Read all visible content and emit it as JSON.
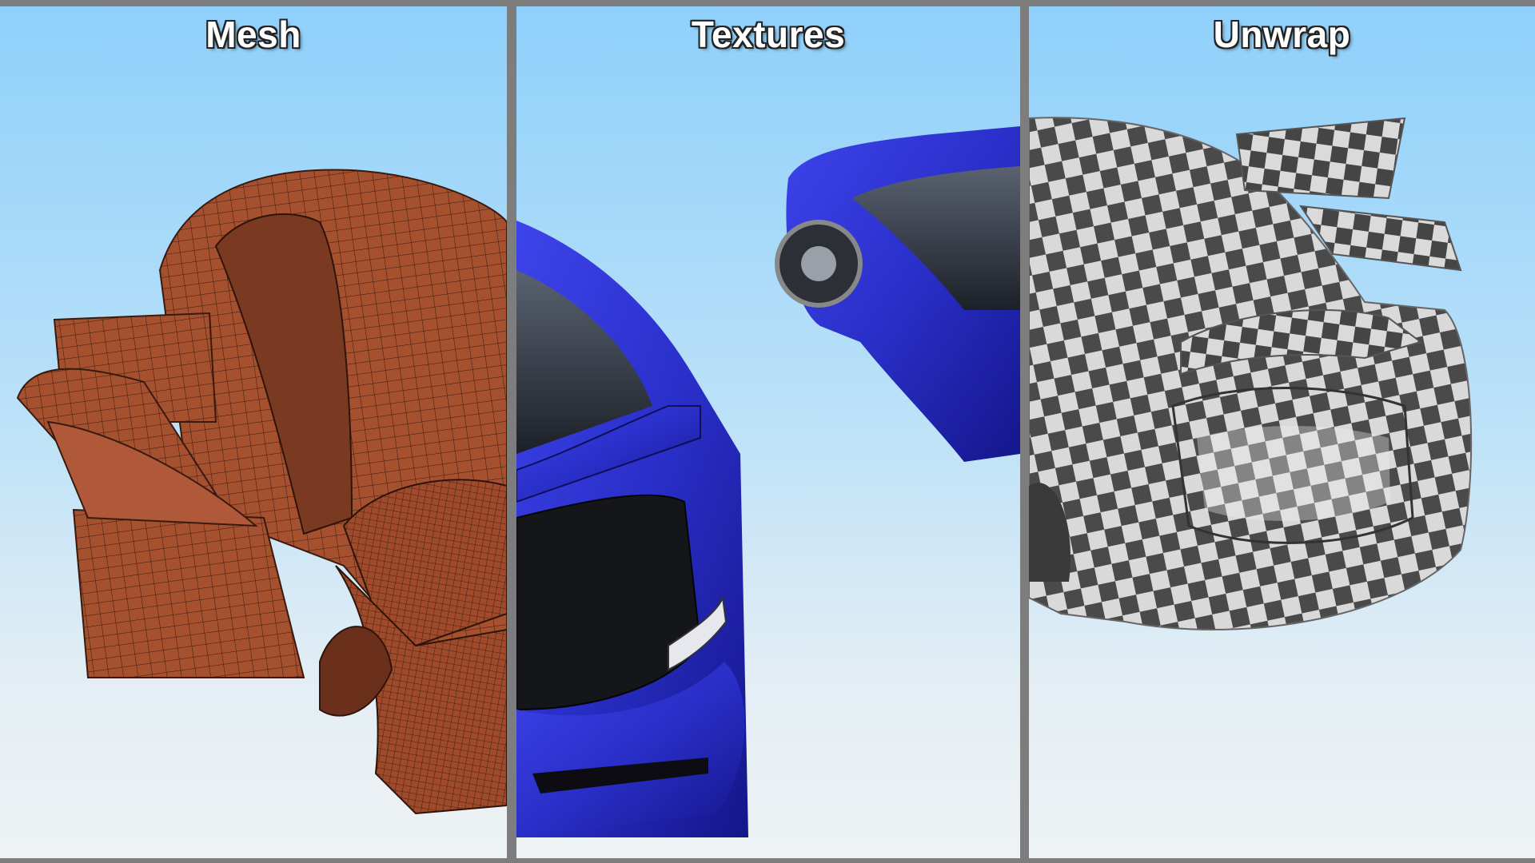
{
  "panels": [
    {
      "title": "Mesh"
    },
    {
      "title": "Textures"
    },
    {
      "title": "Unwrap"
    }
  ],
  "colors": {
    "divider": "#7d7d7d",
    "sky_top": "#8fd0fb",
    "sky_bottom": "#eef2f4",
    "mesh_fill": "#a5502f",
    "mesh_line": "#3a1a0e",
    "car_paint": "#2a2fc9",
    "checker_light": "#d9d9d9",
    "checker_dark": "#4a4a4a"
  }
}
